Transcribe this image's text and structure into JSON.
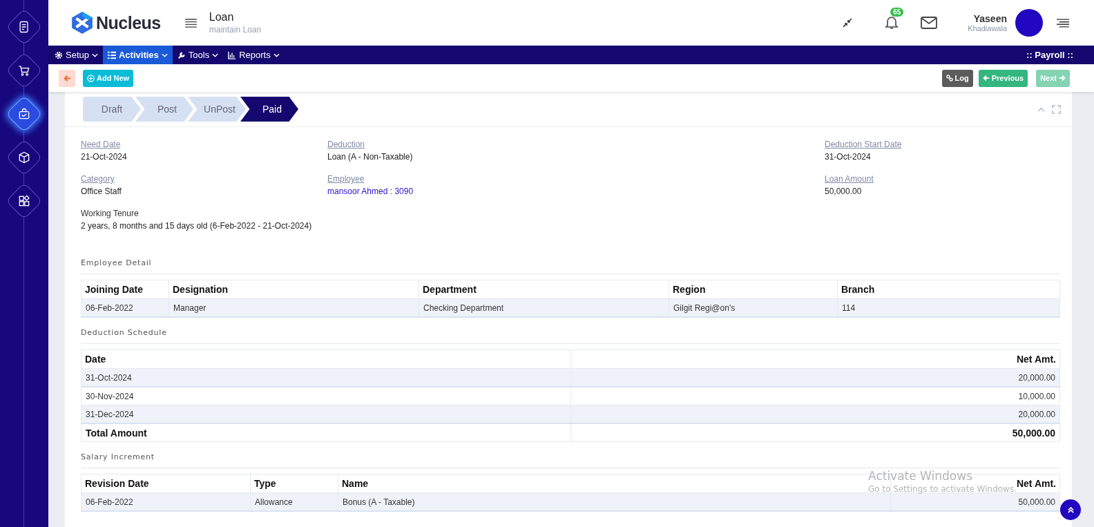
{
  "rail": {
    "items": [
      {
        "kind": "form",
        "selected": false
      },
      {
        "kind": "cart",
        "selected": false
      },
      {
        "kind": "bag",
        "selected": true
      },
      {
        "kind": "cube",
        "selected": false
      },
      {
        "kind": "apps",
        "selected": false
      }
    ]
  },
  "header": {
    "logo": "Nucleus",
    "title": "Loan",
    "subtitle": "maintain Loan",
    "notifications": "65",
    "user_first": "Yaseen",
    "user_last": "Khadiawala"
  },
  "nav": {
    "items": [
      {
        "label": "Setup",
        "kind": "gear",
        "selected": false
      },
      {
        "label": "Activities",
        "kind": "list",
        "selected": true
      },
      {
        "label": "Tools",
        "kind": "wrench",
        "selected": false
      },
      {
        "label": "Reports",
        "kind": "chart",
        "selected": false
      }
    ],
    "module": ":: Payroll ::"
  },
  "toolbar": {
    "add": "Add New",
    "log": "Log",
    "previous": "Previous",
    "next": "Next",
    "next_disabled": true
  },
  "stages": [
    {
      "label": "Draft",
      "selected": false
    },
    {
      "label": "Post",
      "selected": false
    },
    {
      "label": "UnPost",
      "selected": false
    },
    {
      "label": "Paid",
      "selected": true
    }
  ],
  "fields": [
    {
      "label": "Need Date",
      "value": "21-Oct-2024",
      "kind": "plain"
    },
    {
      "label": "Deduction",
      "value": "Loan (A - Non-Taxable)",
      "kind": "plain"
    },
    {
      "label": "Deduction Start Date",
      "value": "31-Oct-2024",
      "kind": "plain"
    },
    {
      "label": "Category",
      "value": "Office Staff",
      "kind": "plain"
    },
    {
      "label": "Employee",
      "value": "mansoor Ahmed : 3090",
      "kind": "link"
    },
    {
      "label": "Loan Amount",
      "value": "50,000.00",
      "kind": "plain"
    }
  ],
  "tenure": {
    "label": "Working Tenure",
    "value": "2 years, 8 months and 15 days old (6-Feb-2022 - 21-Oct-2024)"
  },
  "employee_detail": {
    "title": "Employee Detail",
    "columns": [
      "Joining Date",
      "Designation",
      "Department",
      "Region",
      "Branch"
    ],
    "rows": [
      [
        "06-Feb-2022",
        "Manager",
        "Checking Department",
        "Gilgit Regi@on's",
        "114"
      ]
    ]
  },
  "deduction_schedule": {
    "title": "Deduction Schedule",
    "columns": [
      "Date",
      "Net Amt."
    ],
    "rows": [
      [
        "31-Oct-2024",
        "20,000.00"
      ],
      [
        "30-Nov-2024",
        "10,000.00"
      ],
      [
        "31-Dec-2024",
        "20,000.00"
      ]
    ],
    "total": [
      "Total Amount",
      "50,000.00"
    ]
  },
  "salary_increment": {
    "title": "Salary Increment",
    "columns": [
      "Revision Date",
      "Type",
      "Name",
      "Net Amt."
    ],
    "rows": [
      [
        "06-Feb-2022",
        "Allowance",
        "Bonus (A - Taxable)",
        "50,000.00"
      ]
    ]
  },
  "os_notice": {
    "title": "Activate Windows",
    "text": "Go to Settings to activate Windows."
  }
}
